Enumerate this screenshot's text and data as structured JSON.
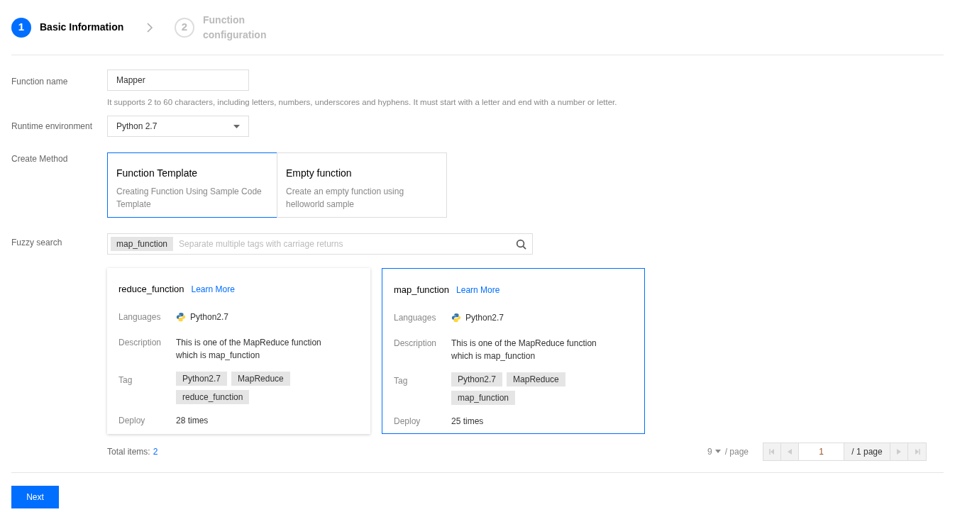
{
  "steps": [
    {
      "number": "1",
      "label": "Basic Information",
      "selected": true
    },
    {
      "number": "2",
      "label": "Function configuration",
      "selected": false
    }
  ],
  "form": {
    "name_label": "Function name",
    "name_value": "Mapper",
    "name_hint": "It supports 2 to 60 characters, including letters, numbers, underscores and hyphens. It must start with a letter and end with a number or letter.",
    "runtime_label": "Runtime environment",
    "runtime_value": "Python 2.7",
    "method_label": "Create Method",
    "methods": [
      {
        "title": "Function Template",
        "description": "Creating Function Using Sample Code Template",
        "selected": true
      },
      {
        "title": "Empty function",
        "description": "Create an empty function using helloworld sample",
        "selected": false
      }
    ],
    "search_label": "Fuzzy search",
    "search_tags": [
      "map_function"
    ],
    "search_placeholder": "Separate multiple tags with carriage returns"
  },
  "templates": [
    {
      "name": "reduce_function",
      "link": "Learn More",
      "languages_label": "Languages",
      "language": "Python2.7",
      "description_label": "Description",
      "description": "This is one of the MapReduce function which is map_function",
      "tag_label": "Tag",
      "tags": [
        "Python2.7",
        "MapReduce",
        "reduce_function"
      ],
      "deploy_label": "Deploy",
      "deploy": "28 times",
      "selected": false
    },
    {
      "name": "map_function",
      "link": "Learn More",
      "languages_label": "Languages",
      "language": "Python2.7",
      "description_label": "Description",
      "description": "This is one of the MapReduce function which is map_function",
      "tag_label": "Tag",
      "tags": [
        "Python2.7",
        "MapReduce",
        "map_function"
      ],
      "deploy_label": "Deploy",
      "deploy": "25 times",
      "selected": true
    }
  ],
  "pagination": {
    "total_label": "Total items:",
    "total": "2",
    "page_size": "9",
    "per_page": "/ page",
    "page": "1",
    "pages": "/ 1 page"
  },
  "next_button": "Next"
}
